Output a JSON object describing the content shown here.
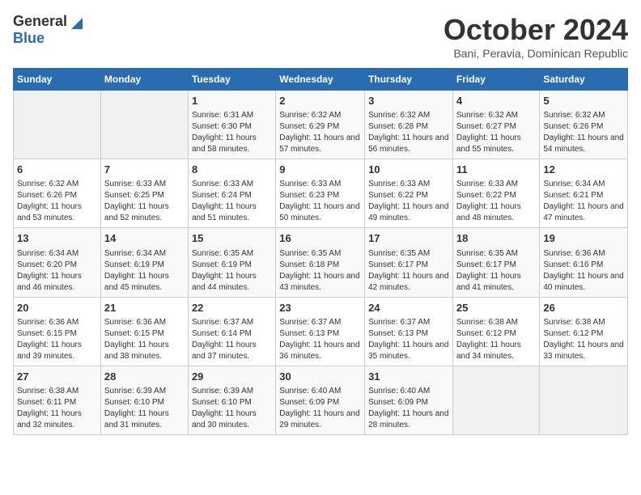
{
  "header": {
    "logo_general": "General",
    "logo_blue": "Blue",
    "month": "October 2024",
    "location": "Bani, Peravia, Dominican Republic"
  },
  "days_of_week": [
    "Sunday",
    "Monday",
    "Tuesday",
    "Wednesday",
    "Thursday",
    "Friday",
    "Saturday"
  ],
  "weeks": [
    [
      {
        "num": "",
        "info": ""
      },
      {
        "num": "",
        "info": ""
      },
      {
        "num": "1",
        "info": "Sunrise: 6:31 AM\nSunset: 6:30 PM\nDaylight: 11 hours and 58 minutes."
      },
      {
        "num": "2",
        "info": "Sunrise: 6:32 AM\nSunset: 6:29 PM\nDaylight: 11 hours and 57 minutes."
      },
      {
        "num": "3",
        "info": "Sunrise: 6:32 AM\nSunset: 6:28 PM\nDaylight: 11 hours and 56 minutes."
      },
      {
        "num": "4",
        "info": "Sunrise: 6:32 AM\nSunset: 6:27 PM\nDaylight: 11 hours and 55 minutes."
      },
      {
        "num": "5",
        "info": "Sunrise: 6:32 AM\nSunset: 6:26 PM\nDaylight: 11 hours and 54 minutes."
      }
    ],
    [
      {
        "num": "6",
        "info": "Sunrise: 6:32 AM\nSunset: 6:26 PM\nDaylight: 11 hours and 53 minutes."
      },
      {
        "num": "7",
        "info": "Sunrise: 6:33 AM\nSunset: 6:25 PM\nDaylight: 11 hours and 52 minutes."
      },
      {
        "num": "8",
        "info": "Sunrise: 6:33 AM\nSunset: 6:24 PM\nDaylight: 11 hours and 51 minutes."
      },
      {
        "num": "9",
        "info": "Sunrise: 6:33 AM\nSunset: 6:23 PM\nDaylight: 11 hours and 50 minutes."
      },
      {
        "num": "10",
        "info": "Sunrise: 6:33 AM\nSunset: 6:22 PM\nDaylight: 11 hours and 49 minutes."
      },
      {
        "num": "11",
        "info": "Sunrise: 6:33 AM\nSunset: 6:22 PM\nDaylight: 11 hours and 48 minutes."
      },
      {
        "num": "12",
        "info": "Sunrise: 6:34 AM\nSunset: 6:21 PM\nDaylight: 11 hours and 47 minutes."
      }
    ],
    [
      {
        "num": "13",
        "info": "Sunrise: 6:34 AM\nSunset: 6:20 PM\nDaylight: 11 hours and 46 minutes."
      },
      {
        "num": "14",
        "info": "Sunrise: 6:34 AM\nSunset: 6:19 PM\nDaylight: 11 hours and 45 minutes."
      },
      {
        "num": "15",
        "info": "Sunrise: 6:35 AM\nSunset: 6:19 PM\nDaylight: 11 hours and 44 minutes."
      },
      {
        "num": "16",
        "info": "Sunrise: 6:35 AM\nSunset: 6:18 PM\nDaylight: 11 hours and 43 minutes."
      },
      {
        "num": "17",
        "info": "Sunrise: 6:35 AM\nSunset: 6:17 PM\nDaylight: 11 hours and 42 minutes."
      },
      {
        "num": "18",
        "info": "Sunrise: 6:35 AM\nSunset: 6:17 PM\nDaylight: 11 hours and 41 minutes."
      },
      {
        "num": "19",
        "info": "Sunrise: 6:36 AM\nSunset: 6:16 PM\nDaylight: 11 hours and 40 minutes."
      }
    ],
    [
      {
        "num": "20",
        "info": "Sunrise: 6:36 AM\nSunset: 6:15 PM\nDaylight: 11 hours and 39 minutes."
      },
      {
        "num": "21",
        "info": "Sunrise: 6:36 AM\nSunset: 6:15 PM\nDaylight: 11 hours and 38 minutes."
      },
      {
        "num": "22",
        "info": "Sunrise: 6:37 AM\nSunset: 6:14 PM\nDaylight: 11 hours and 37 minutes."
      },
      {
        "num": "23",
        "info": "Sunrise: 6:37 AM\nSunset: 6:13 PM\nDaylight: 11 hours and 36 minutes."
      },
      {
        "num": "24",
        "info": "Sunrise: 6:37 AM\nSunset: 6:13 PM\nDaylight: 11 hours and 35 minutes."
      },
      {
        "num": "25",
        "info": "Sunrise: 6:38 AM\nSunset: 6:12 PM\nDaylight: 11 hours and 34 minutes."
      },
      {
        "num": "26",
        "info": "Sunrise: 6:38 AM\nSunset: 6:12 PM\nDaylight: 11 hours and 33 minutes."
      }
    ],
    [
      {
        "num": "27",
        "info": "Sunrise: 6:38 AM\nSunset: 6:11 PM\nDaylight: 11 hours and 32 minutes."
      },
      {
        "num": "28",
        "info": "Sunrise: 6:39 AM\nSunset: 6:10 PM\nDaylight: 11 hours and 31 minutes."
      },
      {
        "num": "29",
        "info": "Sunrise: 6:39 AM\nSunset: 6:10 PM\nDaylight: 11 hours and 30 minutes."
      },
      {
        "num": "30",
        "info": "Sunrise: 6:40 AM\nSunset: 6:09 PM\nDaylight: 11 hours and 29 minutes."
      },
      {
        "num": "31",
        "info": "Sunrise: 6:40 AM\nSunset: 6:09 PM\nDaylight: 11 hours and 28 minutes."
      },
      {
        "num": "",
        "info": ""
      },
      {
        "num": "",
        "info": ""
      }
    ]
  ]
}
